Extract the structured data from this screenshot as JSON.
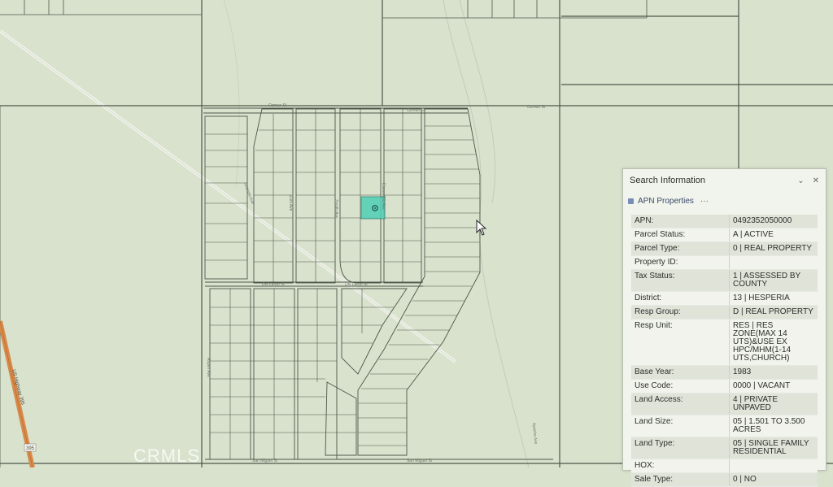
{
  "panel": {
    "title": "Search Information",
    "minimize_label": "⌄",
    "close_label": "✕",
    "sub_title": "APN Properties",
    "sub_menu": "···",
    "rows": [
      {
        "k": "APN:",
        "v": "0492352050000"
      },
      {
        "k": "Parcel Status:",
        "v": "A | ACTIVE"
      },
      {
        "k": "Parcel Type:",
        "v": "0 | REAL PROPERTY"
      },
      {
        "k": "Property ID:",
        "v": ""
      },
      {
        "k": "Tax Status:",
        "v": "1 | ASSESSED BY COUNTY"
      },
      {
        "k": "District:",
        "v": "13 | HESPERIA"
      },
      {
        "k": "Resp Group:",
        "v": "D | REAL PROPERTY"
      },
      {
        "k": "Resp Unit:",
        "v": "RES | RES ZONE(MAX 14 UTS)&USE EX HPC/MHM(1-14 UTS,CHURCH)"
      },
      {
        "k": "Base Year:",
        "v": "1983"
      },
      {
        "k": "Use Code:",
        "v": "0000 | VACANT"
      },
      {
        "k": "Land Access:",
        "v": "4 | PRIVATE UNPAVED"
      },
      {
        "k": "Land Size:",
        "v": "05 | 1.501 TO 3.500 ACRES"
      },
      {
        "k": "Land Type:",
        "v": "05 | SINGLE FAMILY RESIDENTIAL"
      },
      {
        "k": "HOX:",
        "v": ""
      },
      {
        "k": "Sale Type:",
        "v": "0 | NO"
      }
    ]
  },
  "map": {
    "streets": {
      "top": "Ozmun St",
      "top_right": "Ozmun St",
      "middle": "Del Largo St",
      "middle_right": "Del Largo St",
      "bottom": "San Miguel St",
      "bottom_right": "San Miguel St",
      "v1": "Aspen Ave",
      "v2": "Zuni Ave",
      "v3": "Zenith Ave",
      "v4": "Sequoia Ave",
      "v5": "Escondido Ave",
      "v6": "Apache Ave",
      "hwy": "US Highway 395",
      "hwy_shield": "395"
    }
  },
  "watermark": "CRMLS"
}
